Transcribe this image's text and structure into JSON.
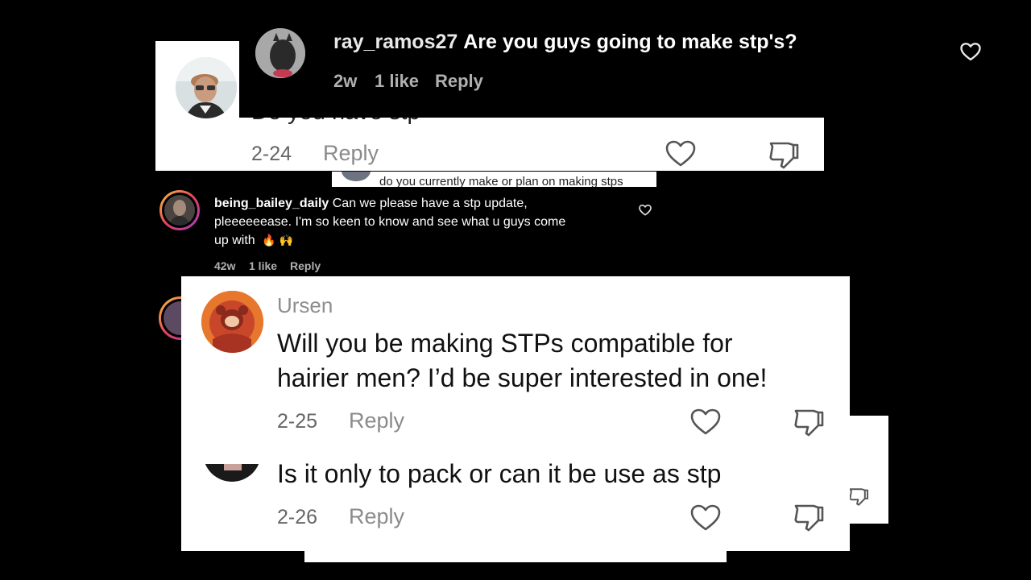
{
  "comment_ray": {
    "username": "ray_ramos27",
    "text": "Are you guys going to make stp's?",
    "time": "2w",
    "likes": "1 like",
    "reply": "Reply"
  },
  "comment_top_white": {
    "partial_text": "Do you have stp",
    "date": "2-24",
    "reply": "Reply"
  },
  "comment_strip": {
    "text": "do you currently make or plan on making stps"
  },
  "comment_bailey": {
    "username": "being_bailey_daily",
    "text_line1": "Can we please have a stp update,",
    "text_line2": "pleeeeeease. I'm so keen to know and see what u guys come",
    "text_line3": "up with",
    "emojis": "🔥 🙌",
    "time": "42w",
    "likes": "1 like",
    "reply": "Reply"
  },
  "comment_ursen": {
    "username": "Ursen",
    "text_line1": "Will you be making STPs compatible for",
    "text_line2": "hairier men? I’d be super interested in one!",
    "date": "2-25",
    "reply": "Reply"
  },
  "comment_pack": {
    "text": "Is it only to pack or can it be use as stp",
    "date": "2-26",
    "reply": "Reply"
  }
}
